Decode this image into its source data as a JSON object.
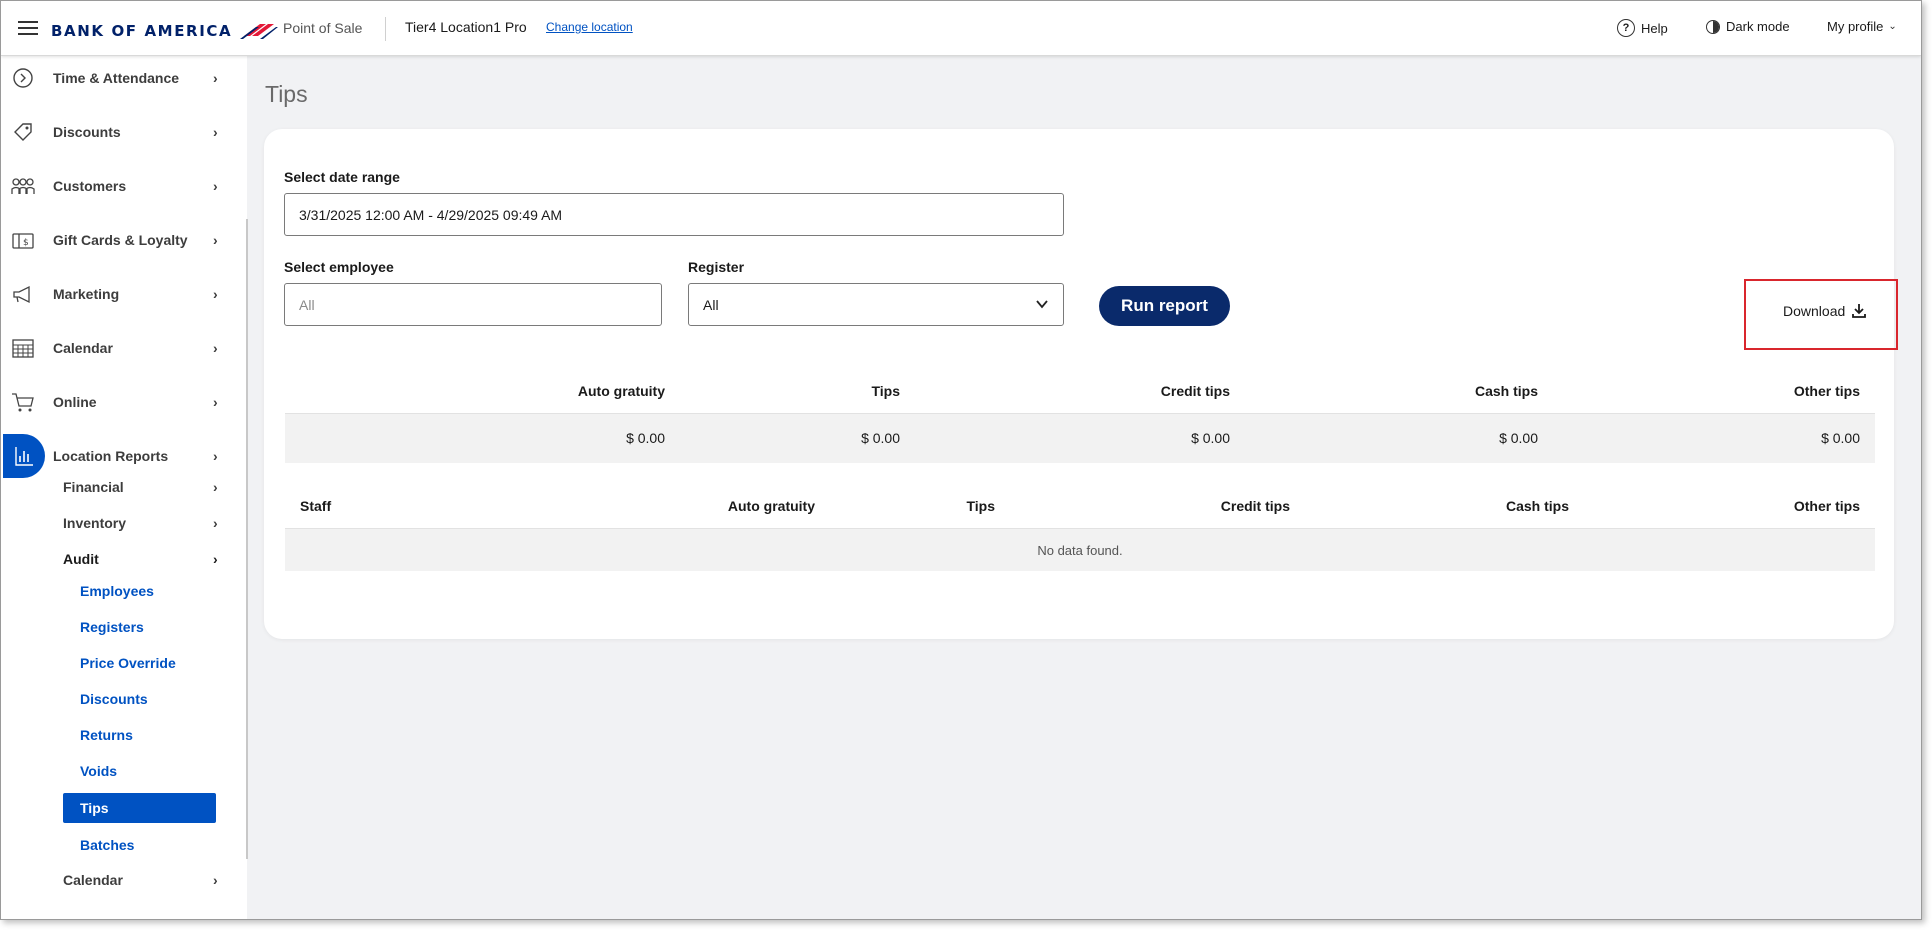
{
  "header": {
    "brand": "BANK OF AMERICA",
    "app_name": "Point of Sale",
    "location_name": "Tier4 Location1 Pro",
    "change_location": "Change location",
    "help": "Help",
    "dark_mode": "Dark mode",
    "my_profile": "My profile"
  },
  "sidebar": {
    "items": [
      {
        "label": "Time & Attendance",
        "icon": "clock-icon"
      },
      {
        "label": "Discounts",
        "icon": "tag-icon"
      },
      {
        "label": "Customers",
        "icon": "people-icon"
      },
      {
        "label": "Gift Cards & Loyalty",
        "icon": "gift-card-icon"
      },
      {
        "label": "Marketing",
        "icon": "megaphone-icon"
      },
      {
        "label": "Calendar",
        "icon": "calendar-icon"
      },
      {
        "label": "Online",
        "icon": "cart-icon"
      },
      {
        "label": "Location Reports",
        "icon": "bar-chart-icon"
      }
    ],
    "report_sub": [
      "Financial",
      "Inventory",
      "Audit"
    ],
    "audit_sub": [
      "Employees",
      "Registers",
      "Price Override",
      "Discounts",
      "Returns",
      "Voids",
      "Tips",
      "Batches"
    ],
    "calendar_sub": "Calendar"
  },
  "page": {
    "title": "Tips"
  },
  "form": {
    "date_range_label": "Select date range",
    "date_range_value": "3/31/2025 12:00 AM - 4/29/2025 09:49 AM",
    "employee_label": "Select employee",
    "employee_placeholder": "All",
    "register_label": "Register",
    "register_value": "All",
    "run_report": "Run report",
    "download": "Download"
  },
  "summary": {
    "headers": [
      "Auto gratuity",
      "Tips",
      "Credit tips",
      "Cash tips",
      "Other tips"
    ],
    "values": [
      "$ 0.00",
      "$ 0.00",
      "$ 0.00",
      "$ 0.00",
      "$ 0.00"
    ]
  },
  "staff_table": {
    "headers": [
      "Staff",
      "Auto gratuity",
      "Tips",
      "Credit tips",
      "Cash tips",
      "Other tips"
    ],
    "empty": "No data found."
  },
  "colors": {
    "brand_navy": "#012169",
    "brand_red": "#e31837",
    "active_blue": "#0052c2",
    "button_navy": "#0a2a6b",
    "highlight_red": "#d9262d"
  }
}
